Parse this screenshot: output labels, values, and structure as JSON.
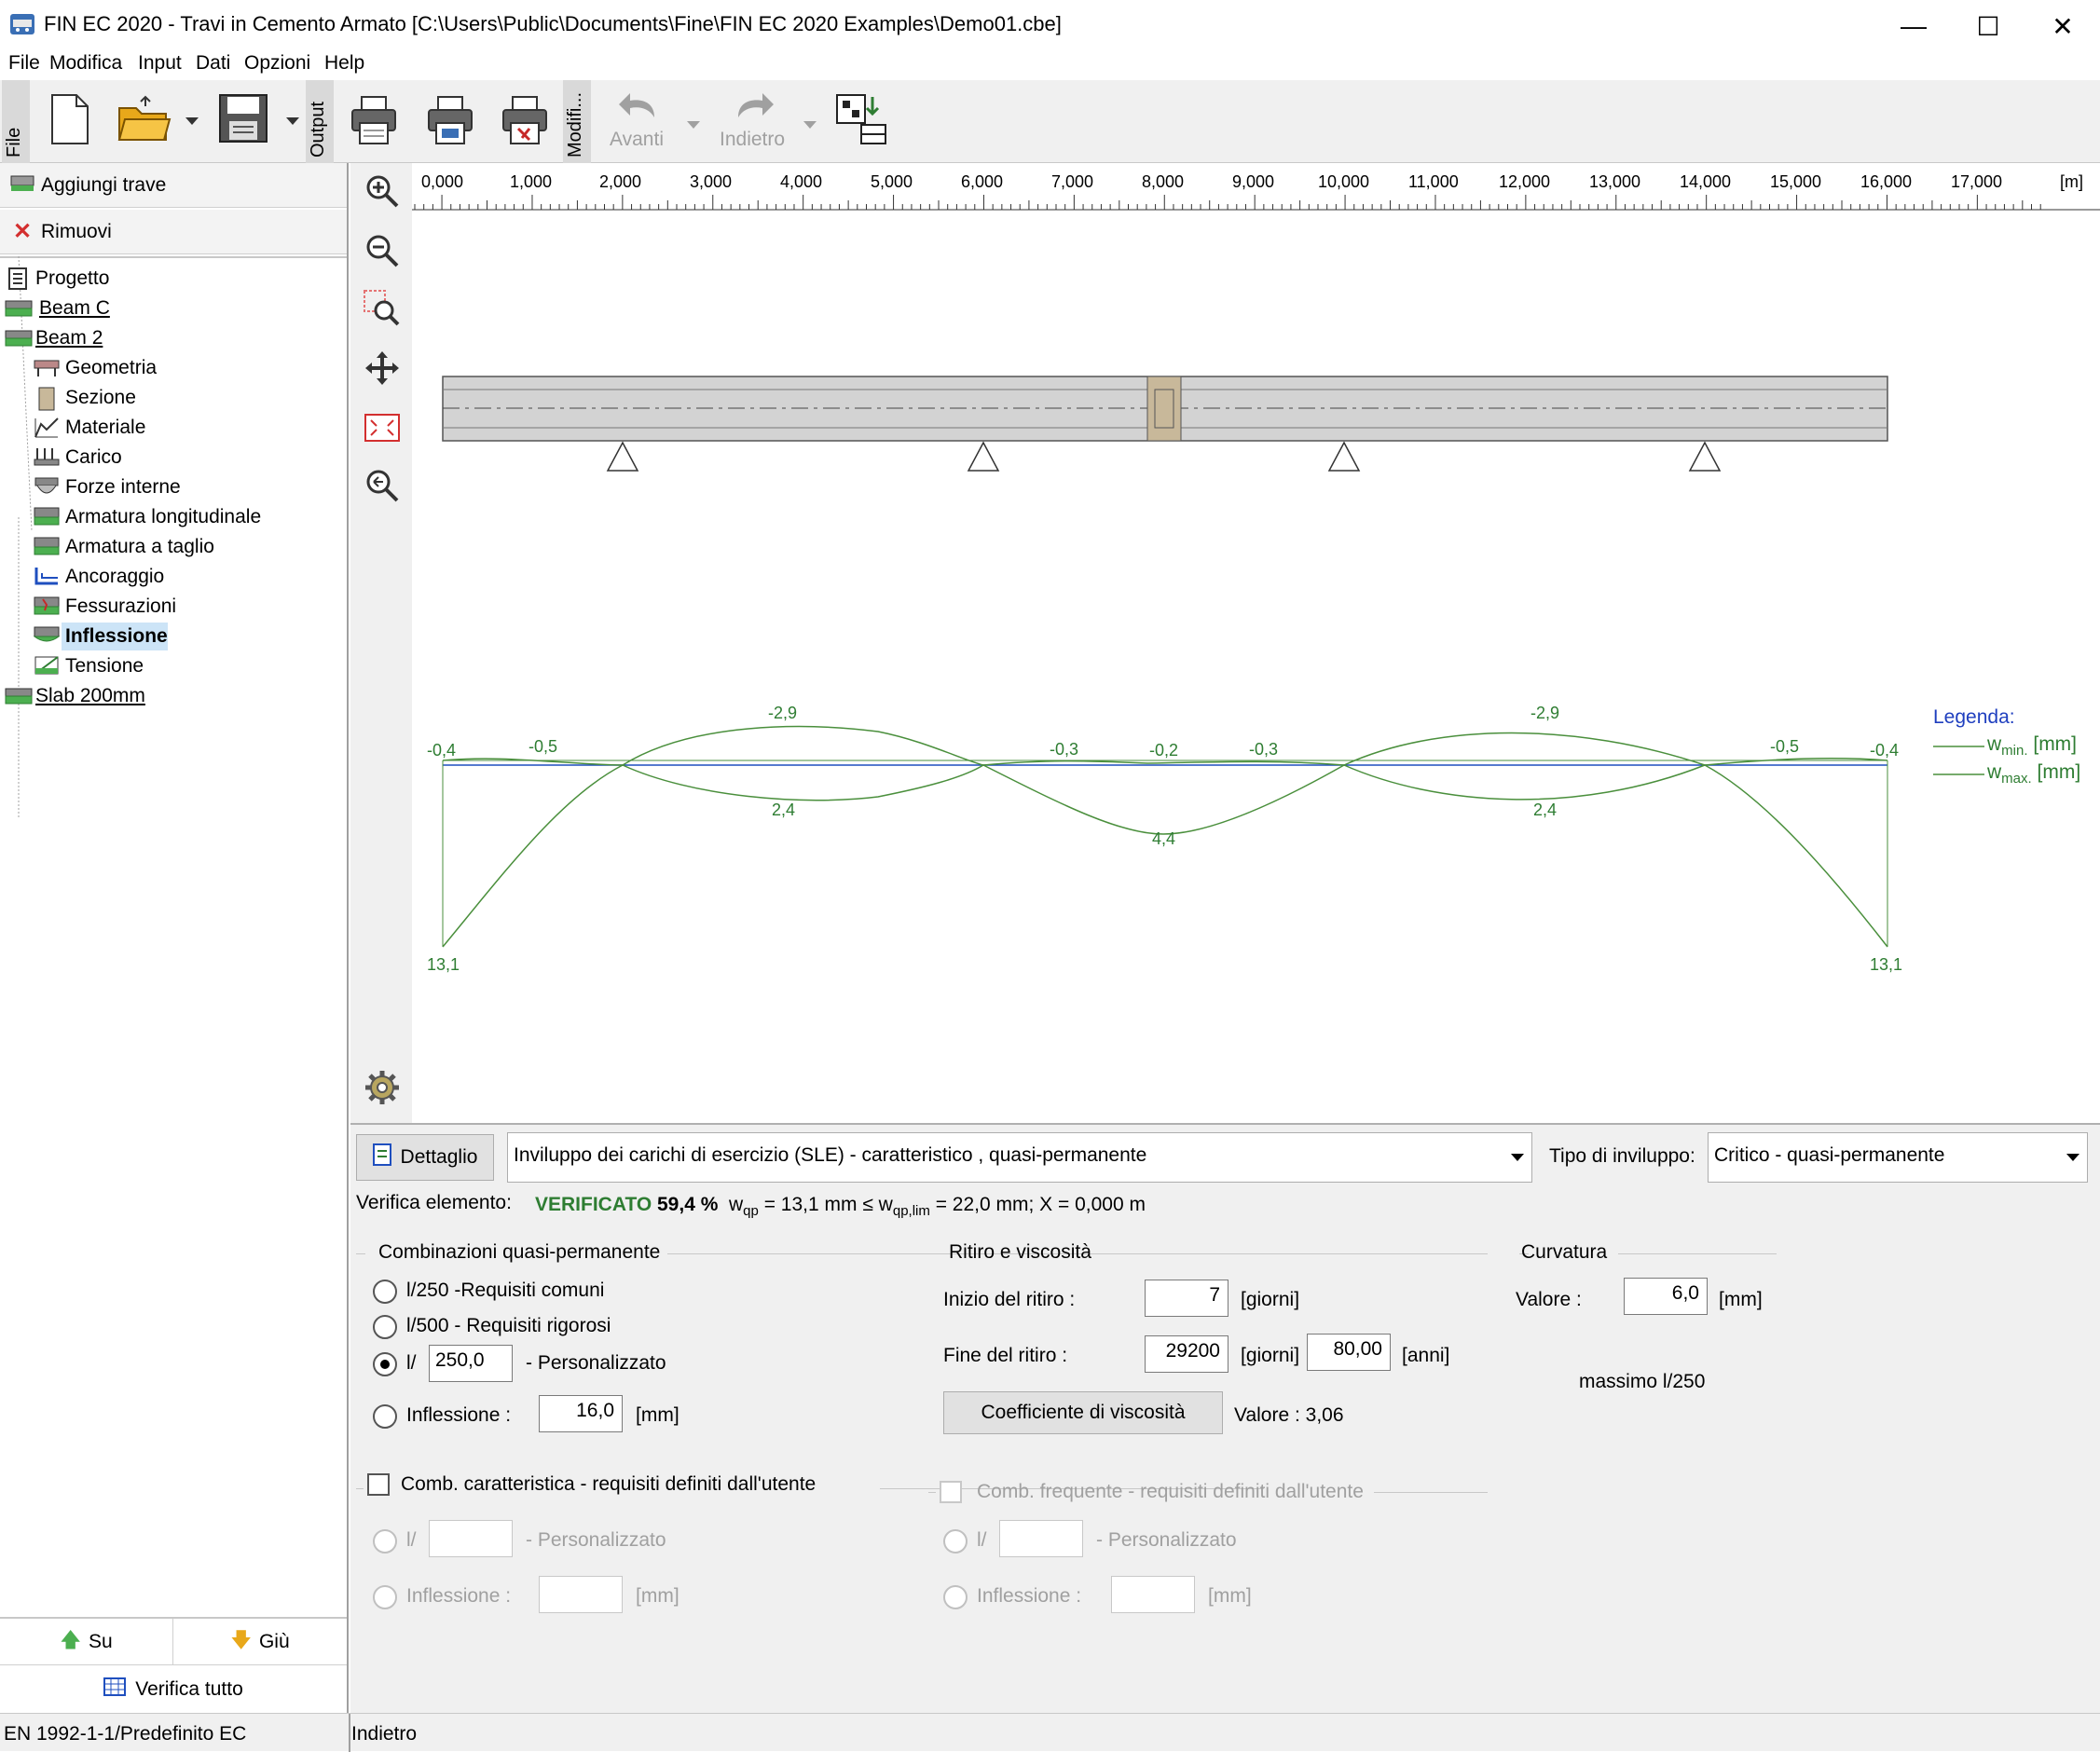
{
  "window": {
    "title": "FIN EC 2020 - Travi in Cemento Armato [C:\\Users\\Public\\Documents\\Fine\\FIN EC 2020 Examples\\Demo01.cbe]",
    "minimize": "—",
    "maximize": "☐",
    "close": "✕"
  },
  "menu": [
    "File",
    "Modifica",
    "Input",
    "Dati",
    "Opzioni",
    "Help"
  ],
  "toolbar": {
    "tab_file": "File",
    "tab_output": "Output",
    "tab_modifica": "Modifi...",
    "undo_label": "Avanti",
    "redo_label": "Indietro"
  },
  "left": {
    "add_beam": "Aggiungi trave",
    "remove": "Rimuovi",
    "tree": [
      {
        "label": "Progetto"
      },
      {
        "label": "Beam C"
      },
      {
        "label": "Beam 2"
      },
      {
        "label": "Geometria"
      },
      {
        "label": "Sezione"
      },
      {
        "label": "Materiale"
      },
      {
        "label": "Carico"
      },
      {
        "label": "Forze interne"
      },
      {
        "label": "Armatura longitudinale"
      },
      {
        "label": "Armatura a taglio"
      },
      {
        "label": "Ancoraggio"
      },
      {
        "label": "Fessurazioni"
      },
      {
        "label": "Inflessione"
      },
      {
        "label": "Tensione"
      },
      {
        "label": "Slab 200mm"
      }
    ],
    "up": "Su",
    "down": "Giù",
    "verify_all": "Verifica tutto"
  },
  "ruler": {
    "ticks": [
      "0,000",
      "1,000",
      "2,000",
      "3,000",
      "4,000",
      "5,000",
      "6,000",
      "7,000",
      "8,000",
      "9,000",
      "10,000",
      "11,000",
      "12,000",
      "13,000",
      "14,000",
      "15,000",
      "16,000",
      "17,000"
    ],
    "unit": "[m]"
  },
  "diagram_labels": {
    "wmin": [
      "-0,4",
      "-0,5",
      "-2,9",
      "-0,3",
      "-0,2",
      "-0,3",
      "-2,9",
      "-0,5",
      "-0,4"
    ],
    "wmax": [
      "13,1",
      "2,4",
      "4,4",
      "2,4",
      "13,1"
    ],
    "legend_title": "Legenda:",
    "legend_min_base": "w",
    "legend_min_sub": "min.",
    "legend_max_sub": "max.",
    "legend_unit": "[mm]"
  },
  "colors": {
    "accent_green": "#2e7d32",
    "line_green": "#4a8f3c",
    "beam_axis": "#1f4fbf",
    "legend_blue": "#1f3fbf",
    "beam_fill": "#d3d3d3",
    "joint_fill": "#c8b89a"
  },
  "bottom": {
    "detail_button": "Dettaglio",
    "combo_loads": "Inviluppo dei carichi di esercizio (SLE) - caratteristico , quasi-permanente",
    "envelope_type_label": "Tipo di inviluppo:",
    "envelope_type": "Critico - quasi-permanente",
    "verification_label": "Verifica elemento:",
    "verified": "VERIFICATO",
    "percent": "59,4 %",
    "formula": {
      "w1": "w",
      "sub1": "qp",
      "mid": " = 13,1 mm ≤ w",
      "sub2": "qp,lim",
      "end": " = 22,0 mm; X = 0,000 m"
    },
    "qp_group": {
      "title": "Combinazioni quasi-permanente",
      "opt1": "l/250 -Requisiti comuni",
      "opt2": "l/500 - Requisiti rigorosi",
      "opt3_prefix": "l/",
      "opt3_value": "250,0",
      "opt3_suffix": "- Personalizzato",
      "opt4": "Inflessione :",
      "opt4_value": "16,0",
      "opt4_unit": "[mm]"
    },
    "creep_group": {
      "title": "Ritiro e viscosità",
      "start_label": "Inizio del ritiro :",
      "start_value": "7",
      "start_unit": "[giorni]",
      "end_label": "Fine del ritiro :",
      "end_days": "29200",
      "end_days_unit": "[giorni]",
      "end_years": "80,00",
      "end_years_unit": "[anni]",
      "coef_button": "Coefficiente di viscosità",
      "value_text": "Valore : 3,06"
    },
    "curv_group": {
      "title": "Curvatura",
      "value_label": "Valore :",
      "value": "6,0",
      "unit": "[mm]",
      "note": "massimo l/250"
    },
    "char_group": {
      "title": "Comb. caratteristica - requisiti definiti dall'utente",
      "opt_l": "l/",
      "personal": "- Personalizzato",
      "defl": "Inflessione :",
      "unit": "[mm]"
    },
    "freq_group": {
      "title": "Comb. frequente - requisiti definiti dall'utente",
      "opt_l": "l/",
      "personal": "- Personalizzato",
      "defl": "Inflessione :",
      "unit": "[mm]"
    }
  },
  "status": {
    "left": "EN 1992-1-1/Predefinito EC",
    "right": "Indietro"
  }
}
